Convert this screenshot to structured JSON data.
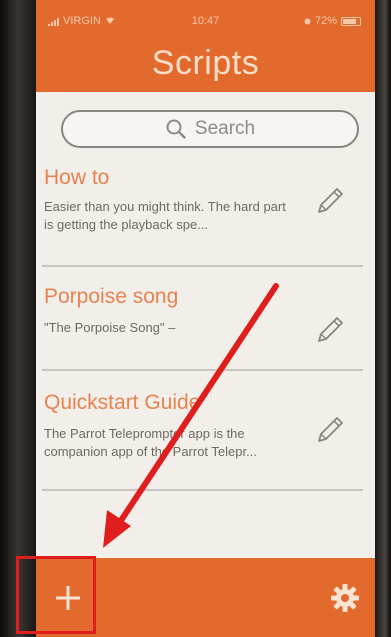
{
  "status_bar": {
    "carrier": "VIRGIN",
    "time": "10:47",
    "battery": "72%"
  },
  "header": {
    "title": "Scripts"
  },
  "search": {
    "placeholder": "Search"
  },
  "scripts": [
    {
      "title": "How to",
      "snippet": "Easier than you might think. The hard part is getting the playback spe..."
    },
    {
      "title": "Porpoise song",
      "snippet": "\"The Porpoise Song\" –"
    },
    {
      "title": "Quickstart Guide",
      "snippet": "The Parrot Teleprompter app is the companion app of the Parrot Telepr..."
    }
  ],
  "colors": {
    "accent": "#e36a2d",
    "title_text": "#e8824f",
    "annotation": "#e01e1e"
  },
  "icons": [
    "search-icon",
    "pencil-icon",
    "plus-icon",
    "gear-icon",
    "battery-icon",
    "signal-icon",
    "wifi-icon",
    "location-icon"
  ]
}
